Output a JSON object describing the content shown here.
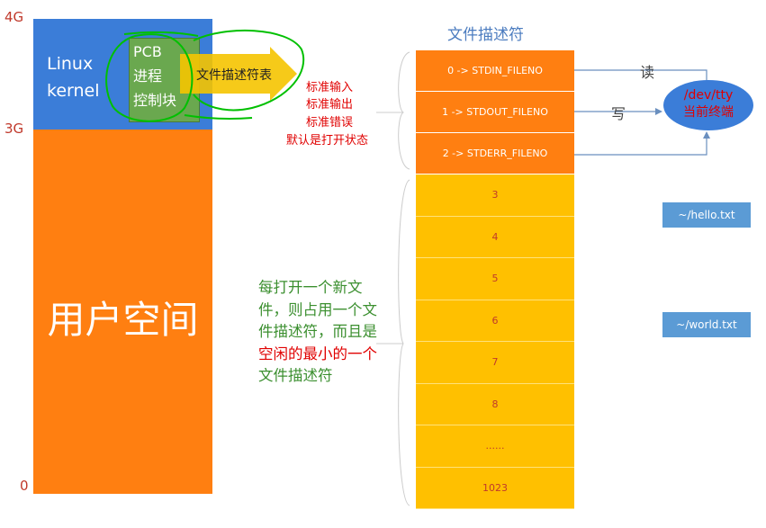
{
  "memory": {
    "addr_4g": "4G",
    "addr_3g": "3G",
    "addr_0": "0",
    "kernel_line1": "Linux",
    "kernel_line2": "kernel",
    "user_space": "用户空间"
  },
  "pcb": {
    "line1": "PCB",
    "line2": "进程",
    "line3": "控制块",
    "arrow_label": "文件描述符表"
  },
  "std_note": {
    "line1": "标准输入",
    "line2": "标准输出",
    "line3": "标准错误",
    "line4": "默认是打开状态"
  },
  "fd_table": {
    "title": "文件描述符",
    "std": [
      "0 -> STDIN_FILENO",
      "1 -> STDOUT_FILENO",
      "2 -> STDERR_FILENO"
    ],
    "free": [
      "3",
      "4",
      "5",
      "6",
      "7",
      "8",
      "......",
      "1023"
    ]
  },
  "terminal": {
    "line1": "/dev/tty",
    "line2": "当前终端",
    "read_label": "读",
    "write_label": "写"
  },
  "files": {
    "hello": "~/hello.txt",
    "world": "~/world.txt"
  },
  "open_note": {
    "p1": "每打开一个新文件，则占用一个文件描述符，而且是",
    "p2": "空闲的最小的一",
    "p3": "个",
    "p4": "文件描述符"
  },
  "colors": {
    "kernel_blue": "#3b7dd8",
    "user_orange": "#ff7f11",
    "fd_free_yellow": "#ffc000",
    "annotation_red": "#e00000",
    "highlight_green": "#00c000"
  }
}
